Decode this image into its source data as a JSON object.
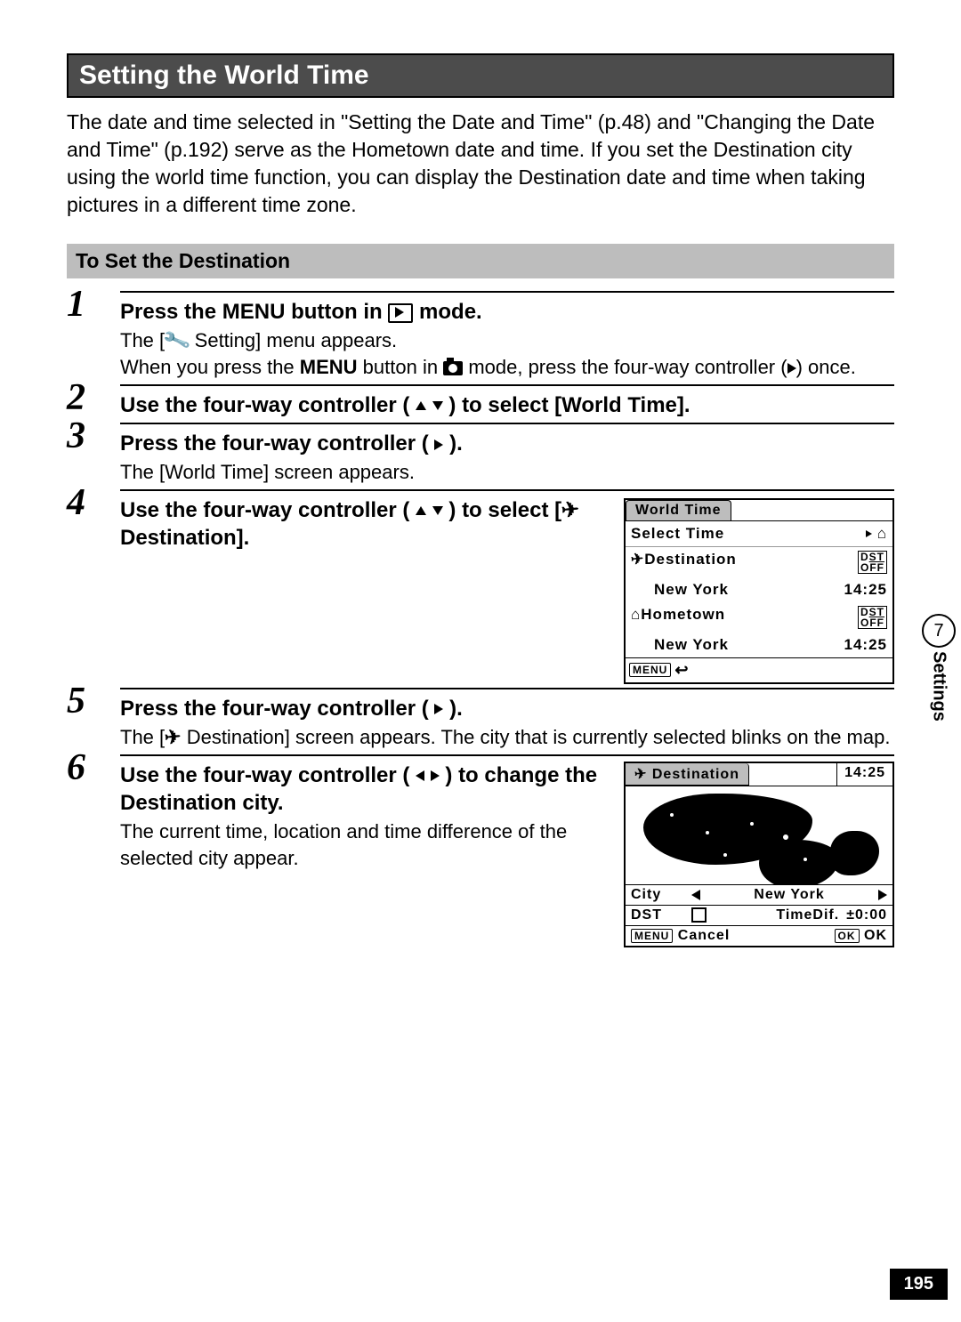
{
  "header": "Setting the World Time",
  "intro": "The date and time selected in \"Setting the Date and Time\" (p.48) and \"Changing the Date and Time\" (p.192) serve as the Hometown date and time. If you set the Destination city using the world time function, you can display the Destination date and time when taking pictures in a different time zone.",
  "subhead": "To Set the Destination",
  "steps": {
    "s1": {
      "num": "1",
      "main_a": "Press the ",
      "main_menu": "MENU",
      "main_b": " button in ",
      "main_c": " mode.",
      "body1a": "The [",
      "body1b": " Setting] menu appears.",
      "body2a": "When you press the ",
      "body2b": " button in ",
      "body2c": " mode, press the four-way controller (",
      "body2d": ") once."
    },
    "s2": {
      "num": "2",
      "main_a": "Use the four-way controller (",
      "main_b": ") to select [World Time]."
    },
    "s3": {
      "num": "3",
      "main_a": "Press the four-way controller (",
      "main_b": ").",
      "body": "The [World Time] screen appears."
    },
    "s4": {
      "num": "4",
      "main_a": "Use the four-way controller (",
      "main_b": ") to select [",
      "main_c": " Destination]."
    },
    "s5": {
      "num": "5",
      "main_a": "Press the four-way controller (",
      "main_b": ").",
      "body_a": "The [",
      "body_b": " Destination] screen appears. The city that is currently selected blinks on the map."
    },
    "s6": {
      "num": "6",
      "main_a": "Use the four-way controller (",
      "main_b": ") to change the Destination city.",
      "body": "The current time, location and time difference of the selected city appear."
    }
  },
  "screen1": {
    "title": "World Time",
    "select_time": "Select Time",
    "dest_label": "Destination",
    "dest_city": "New York",
    "dest_time": "14:25",
    "home_label": "Hometown",
    "home_city": "New York",
    "home_time": "14:25",
    "dst_badge": "DST OFF",
    "menu": "MENU"
  },
  "screen2": {
    "title": "Destination",
    "top_time": "14:25",
    "city_label": "City",
    "city_value": "New York",
    "dst_label": "DST",
    "timedif_label": "TimeDif.",
    "timedif_value": "±0:00",
    "menu": "MENU",
    "cancel": "Cancel",
    "ok": "OK",
    "ok2": "OK"
  },
  "side": {
    "chapter": "7",
    "label": "Settings"
  },
  "page_number": "195"
}
